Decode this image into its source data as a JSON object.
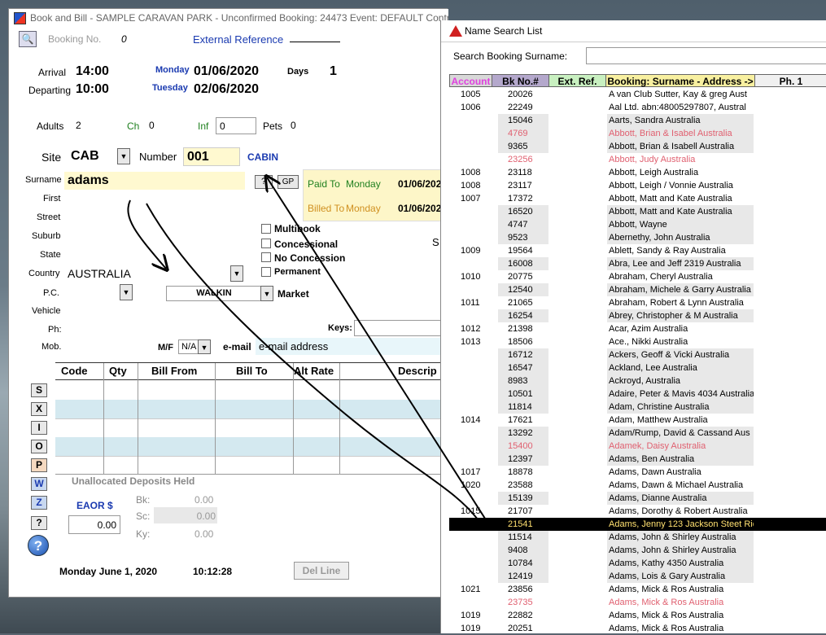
{
  "main": {
    "title": "Book and Bill - SAMPLE CARAVAN PARK - Unconfirmed Booking: 24473 Event: DEFAULT Control: SYSTEM",
    "booking_no_label": "Booking No.",
    "booking_no": "0",
    "ext_ref_label": "External Reference",
    "arrival_label": "Arrival",
    "arrival_time": "14:00",
    "arrival_day": "Monday",
    "arrival_date": "01/06/2020",
    "departing_label": "Departing",
    "departing_time": "10:00",
    "departing_day": "Tuesday",
    "departing_date": "02/06/2020",
    "days_label": "Days",
    "days": "1",
    "adults_label": "Adults",
    "adults": "2",
    "ch_label": "Ch",
    "ch": "0",
    "inf_label": "Inf",
    "inf": "0",
    "pets_label": "Pets",
    "pets": "0",
    "site_label": "Site",
    "site": "CAB",
    "number_label": "Number",
    "number": "001",
    "site_type": "CABIN",
    "surname_label": "Surname",
    "surname": "adams",
    "q_btn": "?",
    "gp_btn": "GP",
    "paid_to_label": "Paid To",
    "paid_to_day": "Monday",
    "paid_to_date": "01/06/202",
    "billed_to_label": "Billed To",
    "billed_to_day": "Monday",
    "billed_to_date": "01/06/202",
    "first_label": "First",
    "street_label": "Street",
    "suburb_label": "Suburb",
    "state_label": "State",
    "country_label": "Country",
    "country": "AUSTRALIA",
    "pc_label": "P.C.",
    "vehicle_label": "Vehicle",
    "ph_label": "Ph:",
    "mob_label": "Mob.",
    "market": "WALKIN",
    "market_label": "Market",
    "keys_label": "Keys:",
    "s_cut": "S",
    "multibook": "Multibook",
    "concessional": "Concessional",
    "no_concession": "No Concession",
    "permanent": "Permanent",
    "mf_label": "M/F",
    "mf": "N/A",
    "email_label": "e-mail",
    "email_placeholder": "e-mail address",
    "grid_headers": [
      "Code",
      "Qty",
      "Bill From",
      "Bill To",
      "Alt Rate",
      "Descrip"
    ],
    "side_buttons": [
      "S",
      "X",
      "I",
      "O",
      "P",
      "W",
      "Z",
      "?"
    ],
    "unalloc_label": "Unallocated Deposits Held",
    "eaor_label": "EAOR $",
    "eaor": "0.00",
    "bk_label": "Bk:",
    "bk": "0.00",
    "sc_label": "Sc:",
    "sc": "0.00",
    "ky_label": "Ky:",
    "ky": "0.00",
    "date_footer": "Monday June 1, 2020",
    "time_footer": "10:12:28",
    "del_line": "Del Line"
  },
  "namelist": {
    "title": "Name Search List",
    "search_label": "Search Booking  Surname:",
    "headers": [
      "Account",
      "Bk No.#",
      "Ext. Ref.",
      "Booking: Surname - Address ->",
      "Ph. 1"
    ],
    "rows": [
      {
        "acc": "1005",
        "bk": "20026",
        "name": "A van Club Sutter, Kay  & greg    Aust"
      },
      {
        "acc": "1006",
        "bk": "22249",
        "name": "Aal Ltd. abn:48005297807,     Austral"
      },
      {
        "acc": "",
        "bk": "15046",
        "name": "Aarts, Sandra     Australia",
        "sh": true
      },
      {
        "acc": "",
        "bk": "4769",
        "name": "Abbott, Brian & Isabel    Australia",
        "sh": true,
        "red": true
      },
      {
        "acc": "",
        "bk": "9365",
        "name": "Abbott, Brian & Isabell    Australia",
        "sh": true
      },
      {
        "acc": "",
        "bk": "23256",
        "name": "Abbott, Judy     Australia",
        "red": true
      },
      {
        "acc": "1008",
        "bk": "23118",
        "name": "Abbott, Leigh     Australia"
      },
      {
        "acc": "1008",
        "bk": "23117",
        "name": "Abbott, Leigh / Vonnie     Australia"
      },
      {
        "acc": "1007",
        "bk": "17372",
        "name": "Abbott, Matt and Kate     Australia"
      },
      {
        "acc": "",
        "bk": "16520",
        "name": "Abbott, Matt and Kate     Australia",
        "sh": true
      },
      {
        "acc": "",
        "bk": "4747",
        "name": "Abbott, Wayne",
        "sh": true
      },
      {
        "acc": "",
        "bk": "9523",
        "name": "Abernethy, John     Australia",
        "sh": true
      },
      {
        "acc": "1009",
        "bk": "19564",
        "name": "Ablett, Sandy & Ray     Australia"
      },
      {
        "acc": "",
        "bk": "16008",
        "name": "Abra, Lee and Jeff    2319 Australia",
        "sh": true
      },
      {
        "acc": "1010",
        "bk": "20775",
        "name": "Abraham, Cheryl     Australia"
      },
      {
        "acc": "",
        "bk": "12540",
        "name": "Abraham, Michele & Garry     Australia",
        "sh": true
      },
      {
        "acc": "1011",
        "bk": "21065",
        "name": "Abraham, Robert & Lynn     Australia"
      },
      {
        "acc": "",
        "bk": "16254",
        "name": "Abrey, Christopher & M     Australia",
        "sh": true
      },
      {
        "acc": "1012",
        "bk": "21398",
        "name": "Acar, Azim     Australia"
      },
      {
        "acc": "1013",
        "bk": "18506",
        "name": "Ace., Nikki     Australia"
      },
      {
        "acc": "",
        "bk": "16712",
        "name": "Ackers, Geoff & Vicki     Australia",
        "sh": true
      },
      {
        "acc": "",
        "bk": "16547",
        "name": "Ackland, Lee     Australia",
        "sh": true
      },
      {
        "acc": "",
        "bk": "8983",
        "name": "Ackroyd,      Australia",
        "sh": true
      },
      {
        "acc": "",
        "bk": "10501",
        "name": "Adaire, Peter & Mavis     4034 Australia",
        "sh": true
      },
      {
        "acc": "",
        "bk": "11814",
        "name": "Adam, Christine     Australia",
        "sh": true
      },
      {
        "acc": "1014",
        "bk": "17621",
        "name": "Adam, Matthew     Australia"
      },
      {
        "acc": "",
        "bk": "13292",
        "name": "Adam/Rump, David & Cassand    Aus",
        "sh": true
      },
      {
        "acc": "",
        "bk": "15400",
        "name": "Adamek, Daisy     Australia",
        "sh": true,
        "red": true
      },
      {
        "acc": "",
        "bk": "12397",
        "name": "Adams, Ben     Australia",
        "sh": true
      },
      {
        "acc": "1017",
        "bk": "18878",
        "name": "Adams, Dawn     Australia"
      },
      {
        "acc": "1020",
        "bk": "23588",
        "name": "Adams, Dawn & Michael     Australia"
      },
      {
        "acc": "",
        "bk": "15139",
        "name": "Adams, Dianne     Australia",
        "sh": true
      },
      {
        "acc": "1015",
        "bk": "21707",
        "name": "Adams, Dorothy & Robert     Australia"
      },
      {
        "acc": "",
        "bk": "21541",
        "name": "Adams, Jenny 123 Jackson Steet Ric",
        "sel": true
      },
      {
        "acc": "",
        "bk": "11514",
        "name": "Adams, John & Shirley     Australia",
        "sh": true
      },
      {
        "acc": "",
        "bk": "9408",
        "name": "Adams, John & Shirley     Australia",
        "sh": true
      },
      {
        "acc": "",
        "bk": "10784",
        "name": "Adams, Kathy     4350 Australia",
        "sh": true
      },
      {
        "acc": "",
        "bk": "12419",
        "name": "Adams, Lois & Gary     Australia",
        "sh": true
      },
      {
        "acc": "1021",
        "bk": "23856",
        "name": "Adams, Mick & Ros     Australia"
      },
      {
        "acc": "",
        "bk": "23735",
        "name": "Adams, Mick & Ros     Australia",
        "red": true
      },
      {
        "acc": "1019",
        "bk": "22882",
        "name": "Adams, Mick & Ros     Australia"
      },
      {
        "acc": "1019",
        "bk": "20251",
        "name": "Adams, Mick & Ros     Australia"
      }
    ]
  }
}
